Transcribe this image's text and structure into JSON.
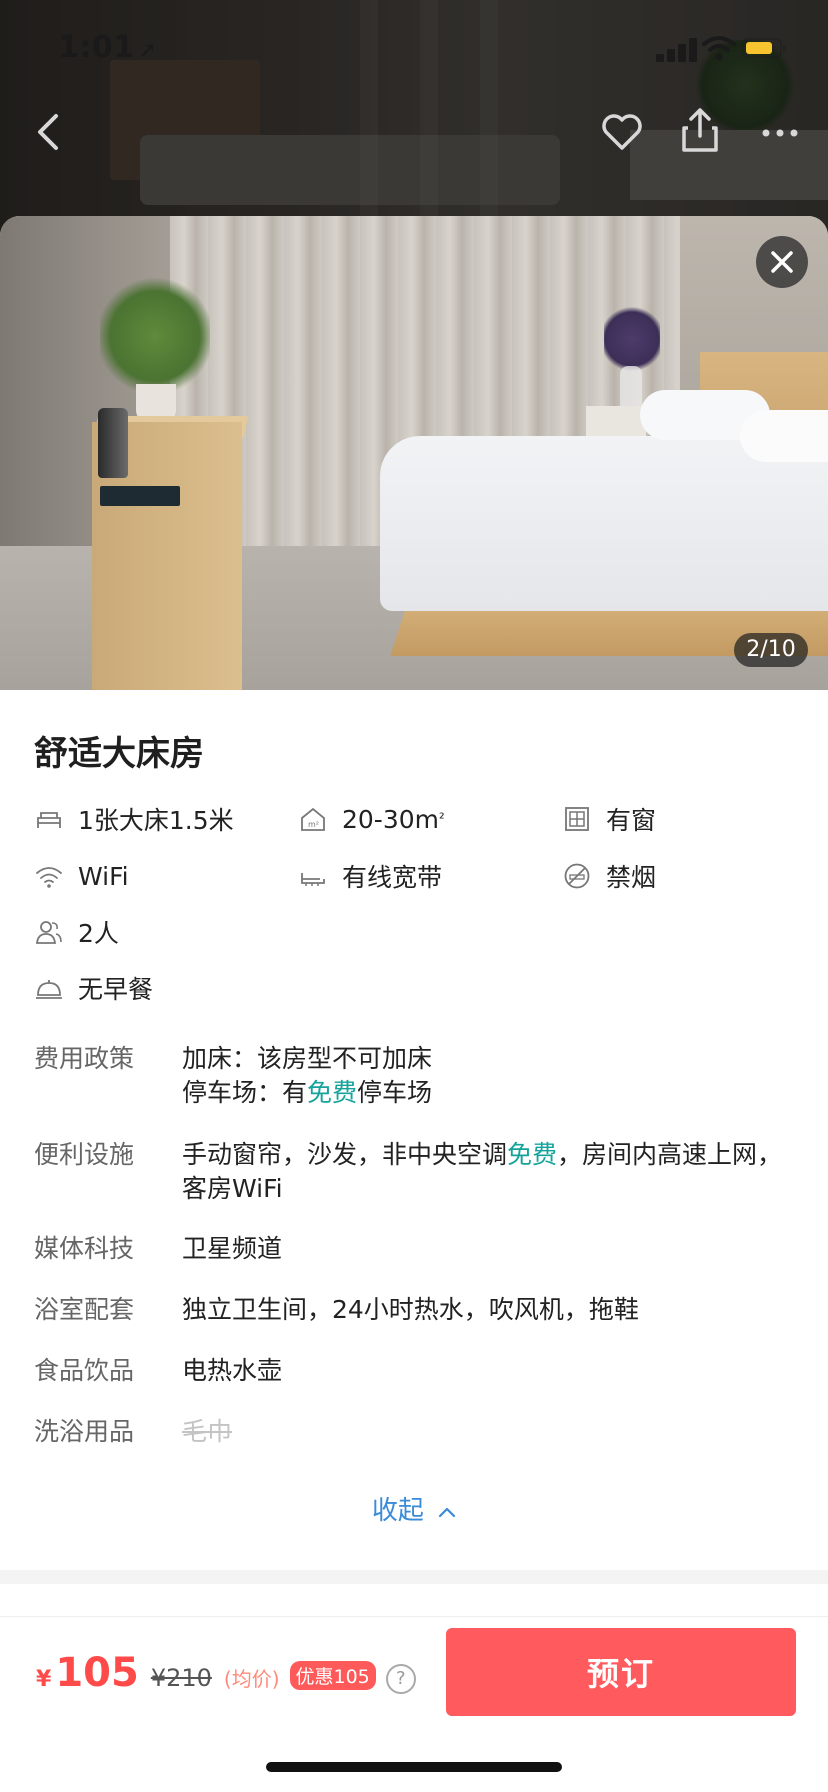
{
  "status_bar": {
    "time": "1:01",
    "location_arrow": "➚"
  },
  "room": {
    "title": "舒适大床房",
    "photo_counter": "2/10",
    "facilities": [
      {
        "icon": "bed-icon",
        "label": "1张大床1.5米"
      },
      {
        "icon": "area-icon",
        "label": "20-30m",
        "suffix": "²"
      },
      {
        "icon": "window-icon",
        "label": "有窗"
      },
      {
        "icon": "wifi-icon",
        "label": "WiFi"
      },
      {
        "icon": "broadband-icon",
        "label": "有线宽带"
      },
      {
        "icon": "no-smoking-icon",
        "label": "禁烟"
      },
      {
        "icon": "guests-icon",
        "label": "2人"
      },
      {
        "icon": "breakfast-icon",
        "label": "无早餐"
      }
    ]
  },
  "policies": {
    "fee": {
      "key": "费用政策",
      "line1": "加床：该房型不可加床",
      "line2_pre": "停车场：有",
      "line2_highlight": "免费",
      "line2_post": "停车场"
    },
    "amenities": {
      "key": "便利设施",
      "pre": "手动窗帘，沙发，非中央空调",
      "highlight": "免费",
      "post": "，房间内高速上网，客房WiFi"
    },
    "media": {
      "key": "媒体科技",
      "value": "卫星频道"
    },
    "bathroom": {
      "key": "浴室配套",
      "value": "独立卫生间，24小时热水，吹风机，拖鞋"
    },
    "food": {
      "key": "食品饮品",
      "value": "电热水壶"
    },
    "toiletries": {
      "key": "洗浴用品",
      "value": "毛巾"
    }
  },
  "collapse_label": "收起",
  "booking": {
    "currency": "¥",
    "price": "105",
    "original_price": "¥210",
    "avg_label": "(均价)",
    "discount_label": "优惠105",
    "help_symbol": "?",
    "book_label": "预订"
  },
  "colors": {
    "price_red": "#ff4a4a",
    "book_button": "#ff5b5e",
    "highlight_teal": "#16a39c",
    "link_blue": "#3a8bd8",
    "battery_yellow": "#f6c42e"
  }
}
